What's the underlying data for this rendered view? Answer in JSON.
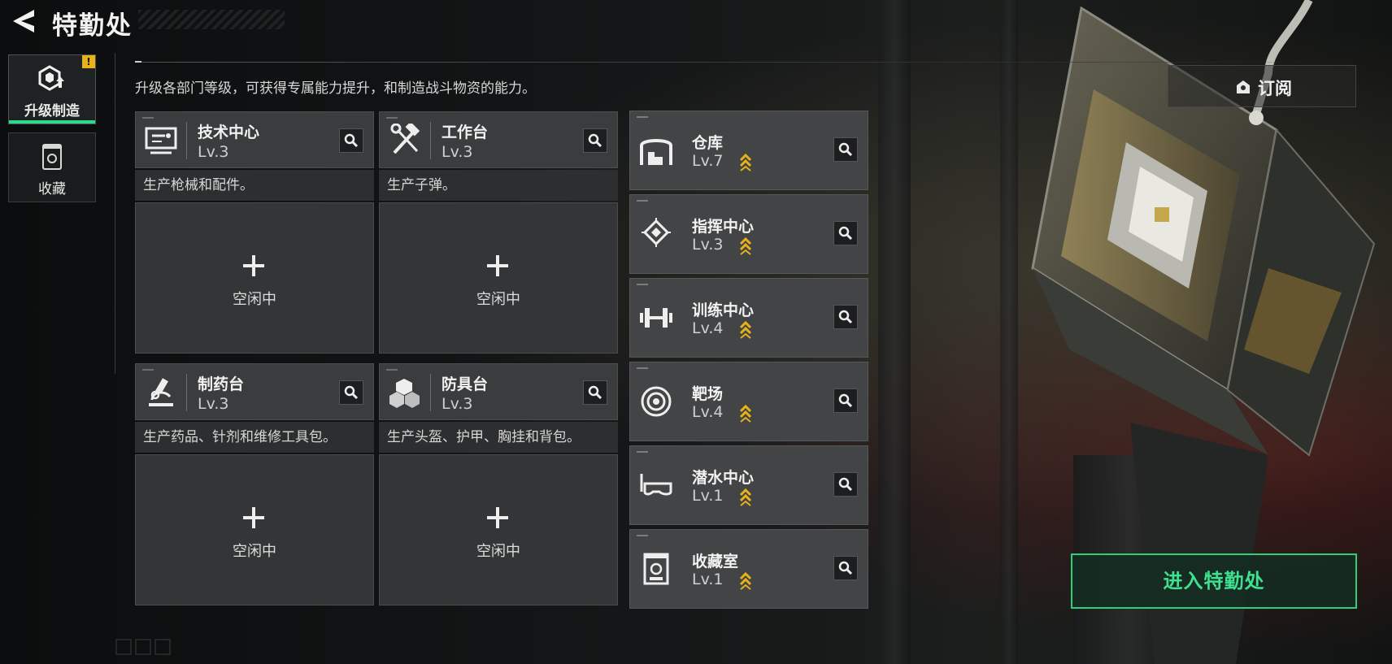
{
  "header": {
    "title": "特勤处"
  },
  "tabs": [
    {
      "label": "升级制造",
      "badge": "!"
    },
    {
      "label": "收藏"
    }
  ],
  "description": "升级各部门等级，可获得专属能力提升，和制造战斗物资的能力。",
  "subscribe_label": "订阅",
  "workstations": [
    {
      "name": "技术中心",
      "level": "Lv.3",
      "subtitle": "生产枪械和配件。",
      "status": "空闲中",
      "icon": "monitor-icon"
    },
    {
      "name": "工作台",
      "level": "Lv.3",
      "subtitle": "生产子弹。",
      "status": "空闲中",
      "icon": "hammer-wrench-icon"
    },
    {
      "name": "制药台",
      "level": "Lv.3",
      "subtitle": "生产药品、针剂和维修工具包。",
      "status": "空闲中",
      "icon": "microscope-icon"
    },
    {
      "name": "防具台",
      "level": "Lv.3",
      "subtitle": "生产头盔、护甲、胸挂和背包。",
      "status": "空闲中",
      "icon": "armor-blocks-icon"
    }
  ],
  "facilities": [
    {
      "name": "仓库",
      "level": "Lv.7",
      "icon": "warehouse-icon"
    },
    {
      "name": "指挥中心",
      "level": "Lv.3",
      "icon": "chip-icon"
    },
    {
      "name": "训练中心",
      "level": "Lv.4",
      "icon": "dumbbell-icon"
    },
    {
      "name": "靶场",
      "level": "Lv.4",
      "icon": "target-icon"
    },
    {
      "name": "潜水中心",
      "level": "Lv.1",
      "icon": "diving-mask-icon"
    },
    {
      "name": "收藏室",
      "level": "Lv.1",
      "icon": "display-case-icon"
    }
  ],
  "enter_button": "进入特勤处",
  "colors": {
    "accent_green": "#2fcf78",
    "upgrade_gold": "#e8b21a",
    "badge_yellow": "#e8b21a"
  }
}
